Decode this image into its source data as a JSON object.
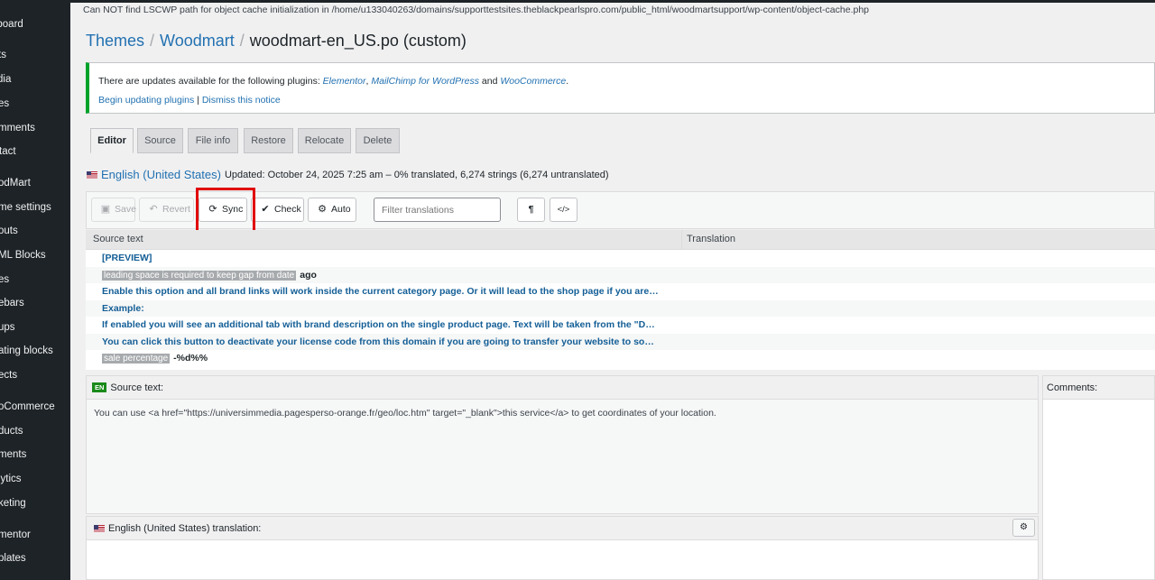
{
  "sidebar": {
    "items": [
      {
        "label": "hboard"
      },
      {
        "label": "ts"
      },
      {
        "label": "dia"
      },
      {
        "label": "es"
      },
      {
        "label": "mments"
      },
      {
        "label": "tact"
      },
      {
        "label": "odMart"
      },
      {
        "label": "me settings"
      },
      {
        "label": "outs"
      },
      {
        "label": "ML Blocks"
      },
      {
        "label": "es"
      },
      {
        "label": "ebars"
      },
      {
        "label": "ups"
      },
      {
        "label": "ating blocks"
      },
      {
        "label": "ects"
      },
      {
        "label": "oCommerce"
      },
      {
        "label": "ducts"
      },
      {
        "label": "ments"
      },
      {
        "label": "lytics"
      },
      {
        "label": "keting"
      },
      {
        "label": "mentor"
      },
      {
        "label": "plates"
      }
    ]
  },
  "lscwp_notice": "Can NOT find LSCWP path for object cache initialization in /home/u133040263/domains/supporttestsites.theblackpearlspro.com/public_html/woodmartsupport/wp-content/object-cache.php",
  "breadcrumb": {
    "themes": "Themes",
    "woodmart": "Woodmart",
    "sep": "/",
    "current": "woodmart-en_US.po (custom)"
  },
  "update_notice": {
    "text_before": "There are updates available for the following plugins: ",
    "plugin1": "Elementor",
    "comma": ", ",
    "plugin2": "MailChimp for WordPress",
    "and": " and ",
    "plugin3": "WooCommerce",
    "period": ".",
    "begin_link": "Begin updating plugins",
    "pipe": " | ",
    "dismiss_link": "Dismiss this notice"
  },
  "tabs": [
    {
      "label": "Editor",
      "active": true
    },
    {
      "label": "Source"
    },
    {
      "label": "File info"
    },
    {
      "label": "Restore"
    },
    {
      "label": "Relocate"
    },
    {
      "label": "Delete"
    }
  ],
  "locale": {
    "name": "English (United States)",
    "meta": "Updated: October 24, 2025 7:25 am – 0% translated, 6,274 strings (6,274 untranslated)"
  },
  "toolbar": {
    "save": "Save",
    "revert": "Revert",
    "sync": "Sync",
    "check": "Check",
    "auto": "Auto",
    "filter_placeholder": "Filter translations",
    "pilcrow": "¶",
    "code": "</>"
  },
  "list": {
    "col_source": "Source text",
    "col_translation": "Translation",
    "rows": [
      {
        "text": "[PREVIEW]"
      },
      {
        "placeholder": "leading space is required to keep gap from date",
        "text": "ago"
      },
      {
        "text": "Enable this option and all brand links will work inside the current category page. Or it will lead to the shop page if you are…"
      },
      {
        "text": "Example:"
      },
      {
        "text": "If enabled you will see an additional tab with brand description on the single product page. Text will be taken from the \"D…"
      },
      {
        "text": "You can click this button to deactivate your license code from this domain if you are going to transfer your website to so…"
      },
      {
        "placeholder": "sale percentage",
        "text": "-%d%%"
      }
    ]
  },
  "source_panel": {
    "badge": "EN",
    "title": "Source text:",
    "body": "You can use <a href=\"https://universimmedia.pagesperso-orange.fr/geo/loc.htm\" target=\"_blank\">this service</a> to get coordinates of your location."
  },
  "translation_panel": {
    "title": "English (United States) translation:"
  },
  "comments": {
    "title": "Comments:"
  },
  "colors": {
    "sidebar_bg": "#1d2327",
    "link": "#2271b1",
    "notice_border": "#00a32a",
    "highlight": "#e00000"
  }
}
